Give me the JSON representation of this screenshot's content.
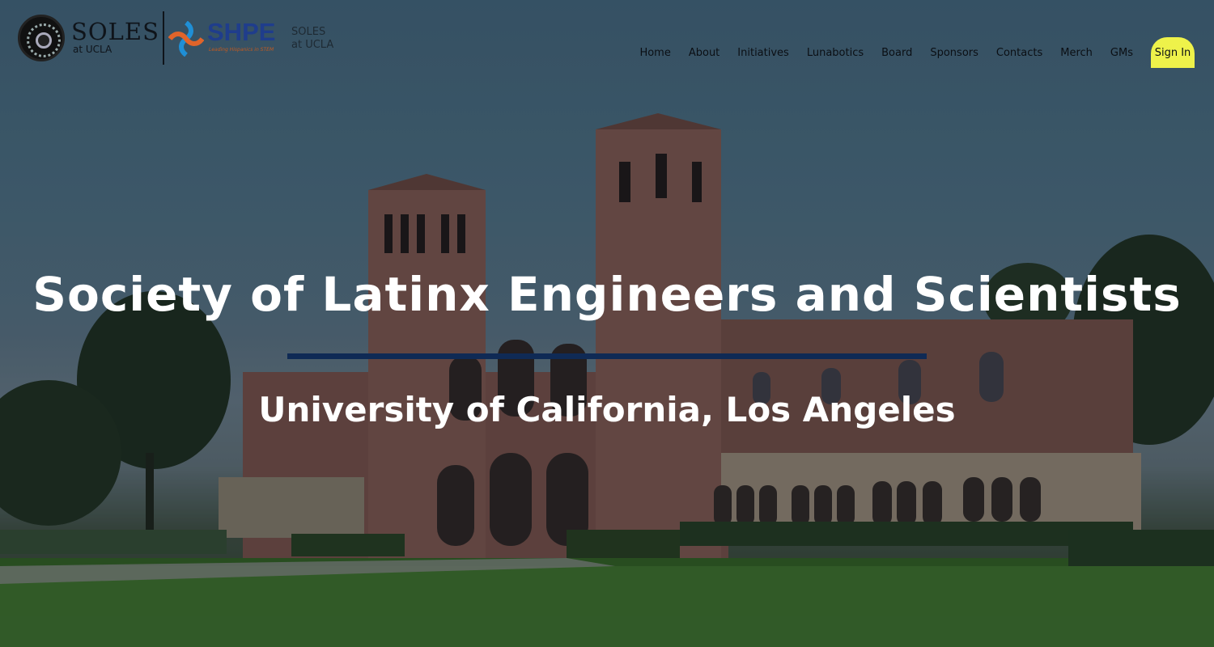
{
  "logo": {
    "soles_word": "SOLES",
    "soles_sub": "at UCLA",
    "shpe_word": "SHPE",
    "shpe_tagline": "Leading Hispanics in STEM",
    "chapter_line1": "SOLES",
    "chapter_line2": "at UCLA"
  },
  "nav": {
    "items": [
      "Home",
      "About",
      "Initiatives",
      "Lunabotics",
      "Board",
      "Sponsors",
      "Contacts",
      "Merch",
      "GMs"
    ],
    "sign_in": "Sign In"
  },
  "hero": {
    "title": "Society of Latinx Engineers and Scientists",
    "subtitle": "University of California, Los Angeles"
  },
  "colors": {
    "sign_in_bg": "#eef24a",
    "rule": "#0f2a55",
    "shpe_blue": "#1f3d8c"
  }
}
